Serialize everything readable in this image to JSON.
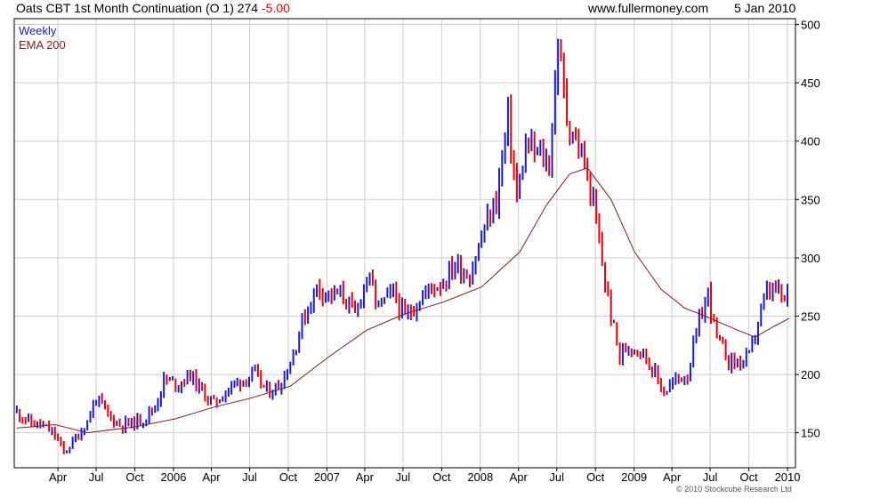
{
  "header": {
    "title": "Oats CBT 1st Month Continuation (O 1) 274",
    "change": "-5.00",
    "website": "www.fullermoney.com",
    "date": "5 Jan 2010"
  },
  "footer": {
    "copyright": "© 2010 Stockcube Research Ltd"
  },
  "colors": {
    "up": "#1a1adc",
    "down": "#e8000b",
    "ema": "#8b1a1a",
    "grid": "#cfcfcf",
    "frame": "#000000"
  },
  "chart_data": {
    "type": "candlestick",
    "legend": [
      {
        "label": "Weekly",
        "color": "#1a1adc"
      },
      {
        "label": "EMA 200",
        "color": "#8b1a1a"
      }
    ],
    "legend_position": "top-left",
    "grid": true,
    "ylim": [
      120,
      505
    ],
    "y_ticks": [
      150,
      200,
      250,
      300,
      350,
      400,
      450,
      500
    ],
    "x_range": [
      "2004-12-18",
      "2010-01-20"
    ],
    "x_ticks": [
      {
        "label": "Apr",
        "date": "2005-04-01"
      },
      {
        "label": "Jul",
        "date": "2005-07-01"
      },
      {
        "label": "Oct",
        "date": "2005-10-01"
      },
      {
        "label": "2006",
        "date": "2006-01-01"
      },
      {
        "label": "Apr",
        "date": "2006-04-01"
      },
      {
        "label": "Jul",
        "date": "2006-07-01"
      },
      {
        "label": "Oct",
        "date": "2006-10-01"
      },
      {
        "label": "2007",
        "date": "2007-01-01"
      },
      {
        "label": "Apr",
        "date": "2007-04-01"
      },
      {
        "label": "Jul",
        "date": "2007-07-01"
      },
      {
        "label": "Oct",
        "date": "2007-10-01"
      },
      {
        "label": "2008",
        "date": "2008-01-01"
      },
      {
        "label": "Apr",
        "date": "2008-04-01"
      },
      {
        "label": "Jul",
        "date": "2008-07-01"
      },
      {
        "label": "Oct",
        "date": "2008-10-01"
      },
      {
        "label": "2009",
        "date": "2009-01-01"
      },
      {
        "label": "Apr",
        "date": "2009-04-01"
      },
      {
        "label": "Jul",
        "date": "2009-07-01"
      },
      {
        "label": "Oct",
        "date": "2009-10-01"
      },
      {
        "label": "2010",
        "date": "2010-01-01"
      }
    ],
    "price_path": [
      [
        "2004-12-24",
        168
      ],
      [
        "2005-01-28",
        158
      ],
      [
        "2005-02-25",
        156
      ],
      [
        "2005-03-25",
        148
      ],
      [
        "2005-04-15",
        133
      ],
      [
        "2005-05-13",
        145
      ],
      [
        "2005-06-10",
        160
      ],
      [
        "2005-07-01",
        180
      ],
      [
        "2005-07-29",
        165
      ],
      [
        "2005-08-26",
        157
      ],
      [
        "2005-09-23",
        158
      ],
      [
        "2005-10-21",
        162
      ],
      [
        "2005-11-18",
        172
      ],
      [
        "2005-12-09",
        195
      ],
      [
        "2006-01-13",
        192
      ],
      [
        "2006-02-10",
        200
      ],
      [
        "2006-03-10",
        185
      ],
      [
        "2006-04-07",
        175
      ],
      [
        "2006-05-12",
        188
      ],
      [
        "2006-06-09",
        195
      ],
      [
        "2006-07-14",
        200
      ],
      [
        "2006-08-11",
        185
      ],
      [
        "2006-09-08",
        190
      ],
      [
        "2006-10-06",
        210
      ],
      [
        "2006-11-03",
        245
      ],
      [
        "2006-12-08",
        275
      ],
      [
        "2007-01-12",
        268
      ],
      [
        "2007-02-09",
        268
      ],
      [
        "2007-03-09",
        250
      ],
      [
        "2007-04-06",
        285
      ],
      [
        "2007-05-04",
        258
      ],
      [
        "2007-06-08",
        270
      ],
      [
        "2007-07-06",
        248
      ],
      [
        "2007-08-03",
        262
      ],
      [
        "2007-09-07",
        275
      ],
      [
        "2007-10-05",
        280
      ],
      [
        "2007-11-02",
        295
      ],
      [
        "2007-12-07",
        285
      ],
      [
        "2008-01-11",
        325
      ],
      [
        "2008-02-08",
        350
      ],
      [
        "2008-03-07",
        420
      ],
      [
        "2008-03-28",
        350
      ],
      [
        "2008-04-18",
        395
      ],
      [
        "2008-05-16",
        390
      ],
      [
        "2008-06-13",
        380
      ],
      [
        "2008-07-04",
        485
      ],
      [
        "2008-07-25",
        420
      ],
      [
        "2008-08-15",
        400
      ],
      [
        "2008-09-05",
        380
      ],
      [
        "2008-09-26",
        345
      ],
      [
        "2008-10-17",
        295
      ],
      [
        "2008-11-07",
        250
      ],
      [
        "2008-11-28",
        215
      ],
      [
        "2008-12-19",
        225
      ],
      [
        "2009-01-16",
        222
      ],
      [
        "2009-02-13",
        205
      ],
      [
        "2009-03-13",
        185
      ],
      [
        "2009-04-10",
        195
      ],
      [
        "2009-05-08",
        200
      ],
      [
        "2009-06-05",
        245
      ],
      [
        "2009-06-26",
        270
      ],
      [
        "2009-07-17",
        230
      ],
      [
        "2009-08-14",
        212
      ],
      [
        "2009-09-11",
        210
      ],
      [
        "2009-10-02",
        215
      ],
      [
        "2009-10-23",
        245
      ],
      [
        "2009-11-13",
        270
      ],
      [
        "2009-12-04",
        272
      ],
      [
        "2009-12-25",
        262
      ],
      [
        "2010-01-05",
        274
      ]
    ],
    "ema_path": [
      [
        "2004-12-24",
        154
      ],
      [
        "2005-03-25",
        157
      ],
      [
        "2005-06-10",
        150
      ],
      [
        "2005-09-30",
        155
      ],
      [
        "2006-01-06",
        162
      ],
      [
        "2006-04-07",
        172
      ],
      [
        "2006-07-07",
        180
      ],
      [
        "2006-10-06",
        190
      ],
      [
        "2007-01-05",
        215
      ],
      [
        "2007-04-06",
        238
      ],
      [
        "2007-07-06",
        252
      ],
      [
        "2007-10-05",
        262
      ],
      [
        "2008-01-04",
        275
      ],
      [
        "2008-04-04",
        305
      ],
      [
        "2008-06-06",
        345
      ],
      [
        "2008-08-01",
        372
      ],
      [
        "2008-09-12",
        377
      ],
      [
        "2008-11-07",
        350
      ],
      [
        "2009-01-02",
        305
      ],
      [
        "2009-03-06",
        273
      ],
      [
        "2009-05-01",
        257
      ],
      [
        "2009-06-19",
        250
      ],
      [
        "2009-09-04",
        238
      ],
      [
        "2009-10-16",
        232
      ],
      [
        "2009-12-04",
        242
      ],
      [
        "2010-01-05",
        248
      ]
    ]
  }
}
